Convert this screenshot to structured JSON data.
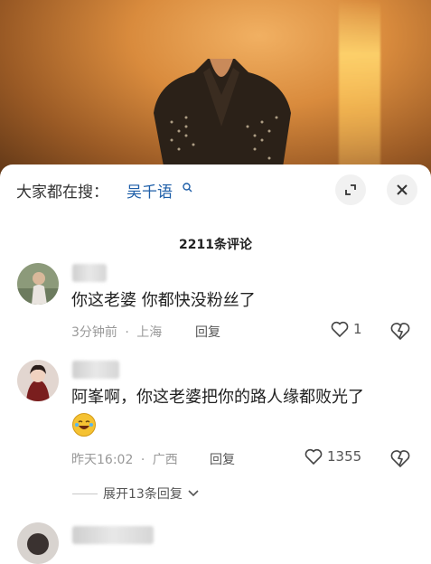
{
  "search": {
    "label": "大家都在搜：",
    "term": "吴千语"
  },
  "comments_header": {
    "count_label": "2211条评论"
  },
  "comments": [
    {
      "text": "你这老婆 你都快没粉丝了",
      "time": "3分钟前",
      "location": "上海",
      "reply_label": "回复",
      "likes": "1"
    },
    {
      "text": "阿峯啊，你这老婆把你的路人缘都败光了",
      "time": "昨天16:02",
      "location": "广西",
      "reply_label": "回复",
      "likes": "1355",
      "emoji": "laughing-crying-emoji",
      "expand_label": "展开13条回复"
    }
  ],
  "meta_separator": "·",
  "colors": {
    "link_blue": "#1d5ea8",
    "meta_gray": "#999999",
    "sheet_bg": "#ffffff"
  },
  "icons": [
    "search-icon",
    "expand-icon",
    "close-icon",
    "heart-icon",
    "dislike-icon",
    "chevron-down-icon"
  ]
}
